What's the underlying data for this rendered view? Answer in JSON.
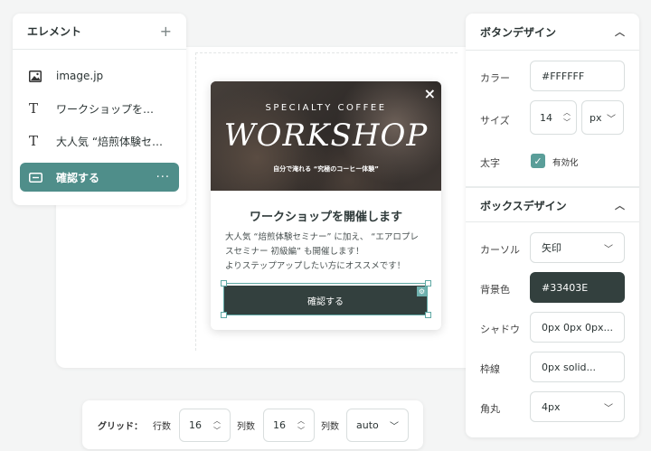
{
  "elements_panel": {
    "title": "エレメント",
    "add_icon": "plus-icon",
    "items": [
      {
        "icon": "image-icon",
        "label": "image.jp"
      },
      {
        "icon": "text-icon",
        "label": "ワークショップを…"
      },
      {
        "icon": "text-icon",
        "label": "大人気 “焙煎体験セ…"
      },
      {
        "icon": "button-icon",
        "label": "確認する",
        "active": true,
        "more": "···"
      }
    ]
  },
  "popup": {
    "hero_small_top": "SPECIALTY COFFEE",
    "hero_big": "WORKSHOP",
    "hero_small_bottom": "自分で淹れる “究極のコーヒー体験”",
    "close_glyph": "×",
    "title": "ワークショップを開催します",
    "body_lines": [
      "大人気 “焙煎体験セミナー” に加え、 “エアロプレ",
      "スセミナー 初級編” も開催します！",
      "よりステップアップしたい方にオススメです！"
    ],
    "button_label": "確認する"
  },
  "button_design": {
    "title": "ボタンデザイン",
    "color_label": "カラー",
    "color_value": "#FFFFFF",
    "size_label": "サイズ",
    "size_value": "14",
    "size_unit": "px",
    "bold_label": "太字",
    "bold_checkbox_label": "有効化",
    "bold_checked": true
  },
  "box_design": {
    "title": "ボックスデザイン",
    "cursor_label": "カーソル",
    "cursor_value": "矢印",
    "bg_label": "背景色",
    "bg_value": "#33403E",
    "shadow_label": "シャドウ",
    "shadow_value": "0px 0px 0px...",
    "border_label": "枠線",
    "border_value": "0px solid...",
    "radius_label": "角丸",
    "radius_value": "4px"
  },
  "grid_bar": {
    "label": "グリッド：",
    "rows_label": "行数",
    "rows_value": "16",
    "cols_label": "列数",
    "cols_value": "16",
    "cols_label2": "列数",
    "auto_value": "auto"
  }
}
